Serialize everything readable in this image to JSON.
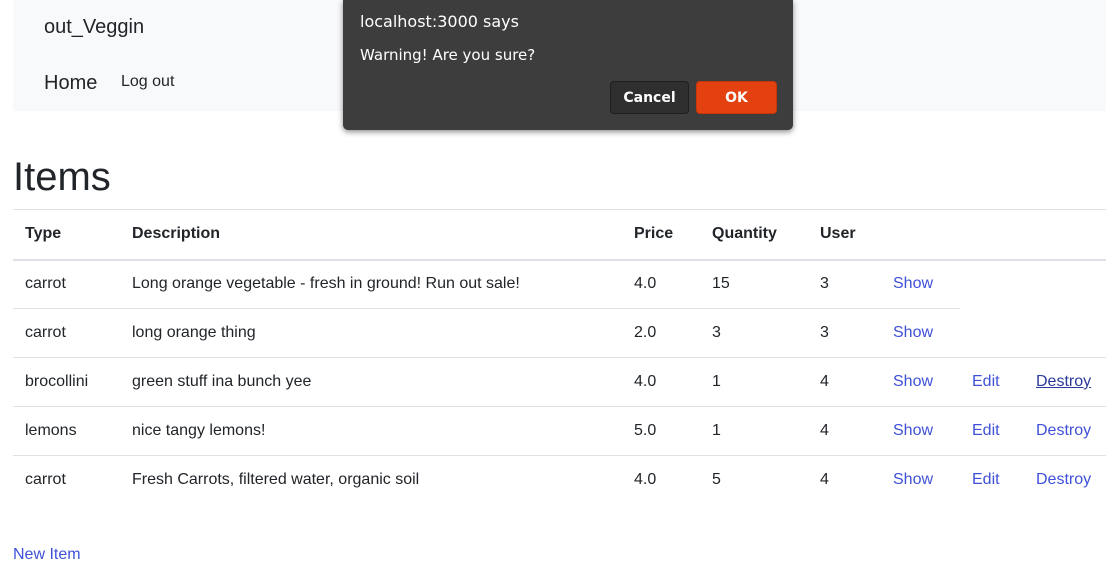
{
  "navbar": {
    "brand": "out_Veggin",
    "home_label": "Home",
    "logout_label": "Log out"
  },
  "page": {
    "title": "Items",
    "new_item_label": "New Item"
  },
  "table": {
    "headers": [
      "Type",
      "Description",
      "Price",
      "Quantity",
      "User"
    ],
    "rows": [
      {
        "type": "carrot",
        "description": "Long orange vegetable - fresh in ground! Run out sale!",
        "price": "4.0",
        "quantity": "15",
        "user": "3",
        "show": "Show"
      },
      {
        "type": "carrot",
        "description": "long orange thing",
        "price": "2.0",
        "quantity": "3",
        "user": "3",
        "show": "Show"
      },
      {
        "type": "brocollini",
        "description": "green stuff ina bunch yee",
        "price": "4.0",
        "quantity": "1",
        "user": "4",
        "show": "Show",
        "edit": "Edit",
        "destroy": "Destroy"
      },
      {
        "type": "lemons",
        "description": "nice tangy lemons!",
        "price": "5.0",
        "quantity": "1",
        "user": "4",
        "show": "Show",
        "edit": "Edit",
        "destroy": "Destroy"
      },
      {
        "type": "carrot",
        "description": "Fresh Carrots, filtered water, organic soil",
        "price": "4.0",
        "quantity": "5",
        "user": "4",
        "show": "Show",
        "edit": "Edit",
        "destroy": "Destroy"
      }
    ]
  },
  "dialog": {
    "title": "localhost:3000 says",
    "message": "Warning! Are you sure?",
    "cancel_label": "Cancel",
    "ok_label": "OK"
  },
  "colors": {
    "link": "#3f51d7",
    "ok_button": "#e3410f",
    "dialog_bg": "#3d3d3d",
    "navbar_bg": "#f8f9fa"
  }
}
